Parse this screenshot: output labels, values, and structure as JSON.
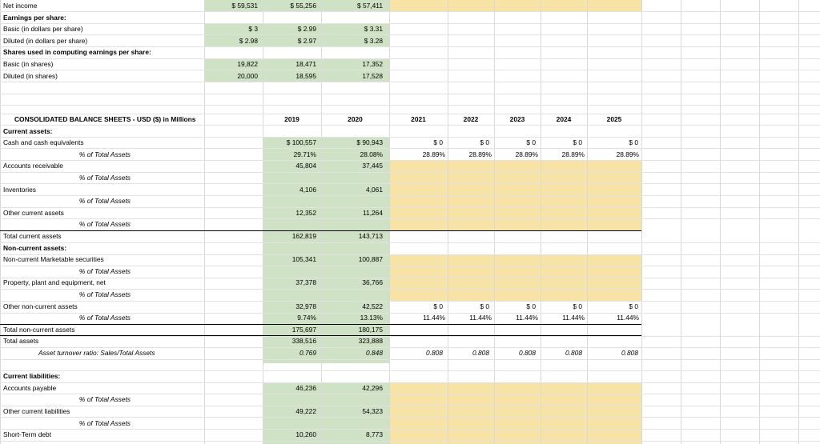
{
  "income": {
    "net_income": {
      "label": "Net income",
      "v2019": "$ 59,531",
      "v2020": "$ 55,256",
      "v2021": "$ 57,411"
    },
    "eps_heading": "Earnings per share:",
    "eps_basic": {
      "label": "Basic (in dollars per share)",
      "v2019": "$ 3",
      "v2020": "$ 2.99",
      "v2021": "$ 3.31"
    },
    "eps_diluted": {
      "label": "Diluted (in dollars per share)",
      "v2019": "$ 2.98",
      "v2020": "$ 2.97",
      "v2021": "$ 3.28"
    },
    "shares_heading": "Shares used in computing earnings per share:",
    "shares_basic": {
      "label": "Basic (in shares)",
      "v2019": "19,822",
      "v2020": "18,471",
      "v2021": "17,352"
    },
    "shares_diluted": {
      "label": "Diluted (in shares)",
      "v2019": "20,000",
      "v2020": "18,595",
      "v2021": "17,528"
    }
  },
  "balance": {
    "title": "CONSOLIDATED BALANCE SHEETS - USD ($) in Millions",
    "years": [
      "2019",
      "2020",
      "2021",
      "2022",
      "2023",
      "2024",
      "2025"
    ],
    "current_assets_heading": "Current assets:",
    "cash": {
      "label": "Cash and cash equivalents",
      "v2019": "$ 100,557",
      "v2020": "$ 90,943",
      "proj": [
        "$ 0",
        "$ 0",
        "$ 0",
        "$ 0",
        "$ 0"
      ]
    },
    "cash_pct": {
      "label": "% of Total Assets",
      "v2019": "29.71%",
      "v2020": "28.08%",
      "proj": [
        "28.89%",
        "28.89%",
        "28.89%",
        "28.89%",
        "28.89%"
      ]
    },
    "ar": {
      "label": "Accounts receivable",
      "v2019": "45,804",
      "v2020": "37,445"
    },
    "ar_pct": {
      "label": "% of Total Assets"
    },
    "inv": {
      "label": "Inventories",
      "v2019": "4,106",
      "v2020": "4,061"
    },
    "inv_pct": {
      "label": "% of Total Assets"
    },
    "oca": {
      "label": "Other current assets",
      "v2019": "12,352",
      "v2020": "11,264"
    },
    "oca_pct": {
      "label": "% of Total Assets"
    },
    "tca": {
      "label": "Total current assets",
      "v2019": "162,819",
      "v2020": "143,713"
    },
    "ncurr_heading": "Non-current assets:",
    "mkt": {
      "label": "Non-current Marketable securities",
      "v2019": "105,341",
      "v2020": "100,887"
    },
    "mkt_pct": {
      "label": "% of Total Assets"
    },
    "ppe": {
      "label": "Property, plant and equipment, net",
      "v2019": "37,378",
      "v2020": "36,766"
    },
    "ppe_pct": {
      "label": "% of Total Assets"
    },
    "onca": {
      "label": "Other non-current assets",
      "v2019": "32,978",
      "v2020": "42,522",
      "proj": [
        "$ 0",
        "$ 0",
        "$ 0",
        "$ 0",
        "$ 0"
      ]
    },
    "onca_pct": {
      "label": "% of Total Assets",
      "v2019": "9.74%",
      "v2020": "13.13%",
      "proj": [
        "11.44%",
        "11.44%",
        "11.44%",
        "11.44%",
        "11.44%"
      ]
    },
    "tnca": {
      "label": "Total non-current assets",
      "v2019": "175,697",
      "v2020": "180,175"
    },
    "ta": {
      "label": "Total assets",
      "v2019": "338,516",
      "v2020": "323,888"
    },
    "turnover": {
      "label": "Asset turnover ratio: Sales/Total Assets",
      "v2019": "0.769",
      "v2020": "0.848",
      "proj": [
        "0.808",
        "0.808",
        "0.808",
        "0.808",
        "0.808"
      ]
    },
    "cl_heading": "Current liabilities:",
    "ap": {
      "label": "Accounts payable",
      "v2019": "46,236",
      "v2020": "42,296"
    },
    "ap_pct": {
      "label": "% of Total Assets"
    },
    "ocl": {
      "label": "Other current liabilities",
      "v2019": "49,222",
      "v2020": "54,323"
    },
    "ocl_pct": {
      "label": "% of Total Assets"
    },
    "std": {
      "label": "Short-Term debt",
      "v2019": "10,260",
      "v2020": "8,773"
    }
  }
}
